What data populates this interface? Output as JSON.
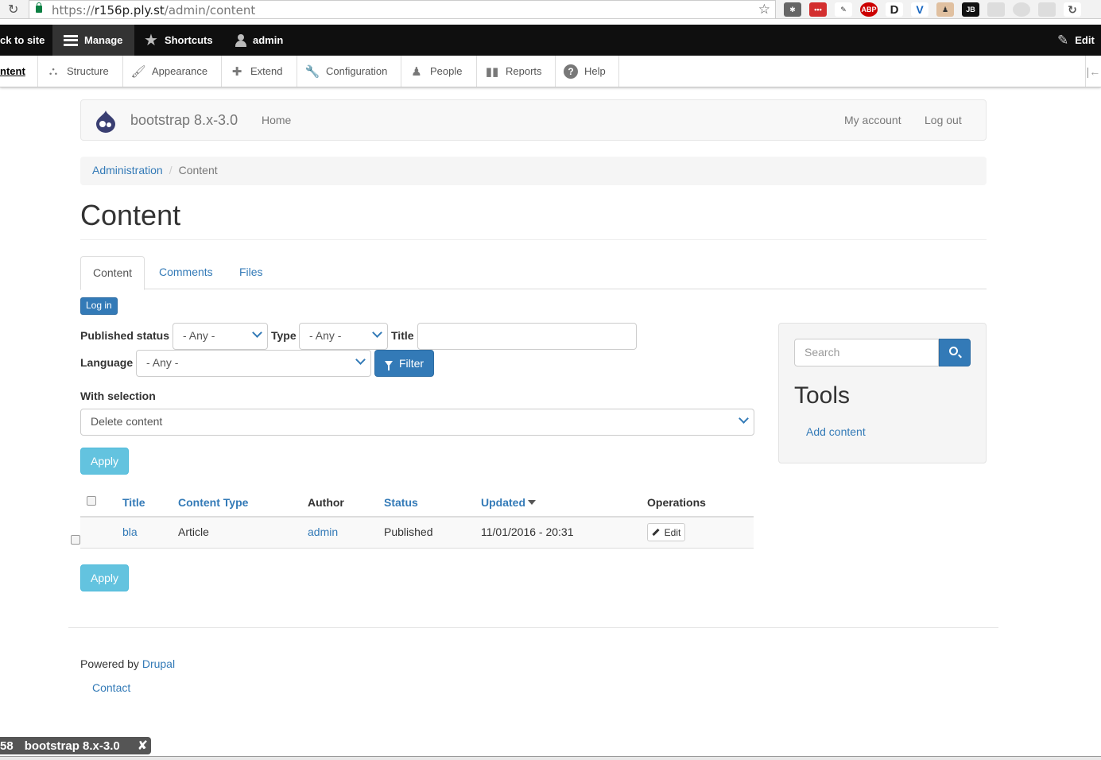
{
  "browser": {
    "url_prefix": "https://",
    "url_host": "r156p.ply.st",
    "url_path": "/admin/content"
  },
  "toolbar": {
    "back_to_site": "ck to site",
    "manage": "Manage",
    "shortcuts": "Shortcuts",
    "user": "admin",
    "edit": "Edit"
  },
  "tray": {
    "content": "ntent",
    "structure": "Structure",
    "appearance": "Appearance",
    "extend": "Extend",
    "configuration": "Configuration",
    "people": "People",
    "reports": "Reports",
    "help": "Help"
  },
  "navbar": {
    "brand": "bootstrap 8.x-3.0",
    "home": "Home",
    "my_account": "My account",
    "log_out": "Log out"
  },
  "breadcrumb": {
    "administration": "Administration",
    "current": "Content"
  },
  "page_title": "Content",
  "tabs": [
    "Content",
    "Comments",
    "Files"
  ],
  "login_button": "Log in",
  "filters": {
    "published_status_label": "Published status",
    "published_status_value": "- Any -",
    "type_label": "Type",
    "type_value": "- Any -",
    "title_label": "Title",
    "title_value": "",
    "language_label": "Language",
    "language_value": "- Any -",
    "filter_button": "Filter"
  },
  "bulk": {
    "with_selection_label": "With selection",
    "action_value": "Delete content",
    "apply_label": "Apply"
  },
  "table": {
    "headers": {
      "title": "Title",
      "content_type": "Content Type",
      "author": "Author",
      "status": "Status",
      "updated": "Updated",
      "operations": "Operations"
    },
    "rows": [
      {
        "title": "bla",
        "content_type": "Article",
        "author": "admin",
        "status": "Published",
        "updated": "11/01/2016 - 20:31",
        "edit": "Edit"
      }
    ]
  },
  "sidebar": {
    "search_placeholder": "Search",
    "tools_heading": "Tools",
    "add_content": "Add content"
  },
  "footer": {
    "powered_by": "Powered by",
    "drupal": "Drupal",
    "contact": "Contact"
  },
  "taskbar": {
    "num": "58",
    "title": "bootstrap 8.x-3.0",
    "close": "✘"
  },
  "colors": {
    "primary": "#337ab7",
    "info": "#5bc0de",
    "toolbar": "#0f0f0f"
  }
}
